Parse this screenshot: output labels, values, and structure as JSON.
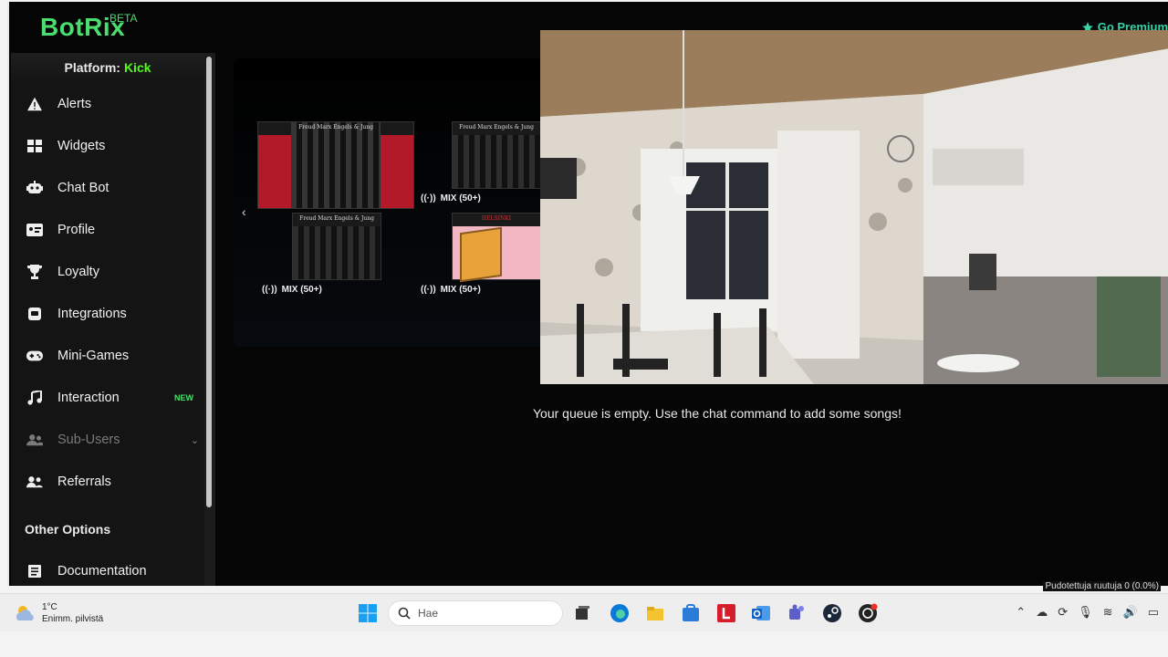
{
  "header": {
    "logo": "BotRix",
    "beta": "BETA",
    "premium": "Go Premium"
  },
  "sidebar": {
    "platform_label": "Platform:",
    "platform_value": "Kick",
    "items": [
      {
        "label": "Alerts",
        "icon": "warning-icon"
      },
      {
        "label": "Widgets",
        "icon": "grid-icon"
      },
      {
        "label": "Chat Bot",
        "icon": "robot-icon"
      },
      {
        "label": "Profile",
        "icon": "id-card-icon"
      },
      {
        "label": "Loyalty",
        "icon": "trophy-icon"
      },
      {
        "label": "Integrations",
        "icon": "integration-icon"
      },
      {
        "label": "Mini-Games",
        "icon": "gamepad-icon"
      },
      {
        "label": "Interaction",
        "icon": "music-icon",
        "badge": "NEW"
      },
      {
        "label": "Sub-Users",
        "icon": "users-icon"
      },
      {
        "label": "Referrals",
        "icon": "referrals-icon"
      }
    ],
    "other_options": "Other Options",
    "documentation": "Documentation"
  },
  "carousel": {
    "prev_glyph": "‹",
    "tiles": [
      {
        "caption": "Freud Marx Engels & Jung",
        "label": ""
      },
      {
        "caption": "Freud Marx Engels & Jung",
        "label": "MIX (50+)"
      },
      {
        "caption": "Freud Marx Engels & Jung",
        "label": "MIX (50+)"
      },
      {
        "caption": "HELSINKI",
        "label": "MIX (50+)"
      }
    ]
  },
  "player": {
    "queue_message": "Your queue is empty. Use the chat command to add some songs!"
  },
  "obs_status": "Pudotettuja ruutuja 0 (0.0%)",
  "taskbar": {
    "temperature": "1°C",
    "weather_desc": "Enimm. pilvistä",
    "search_placeholder": "Hae",
    "accent_edge": "#0a7ad6",
    "accent_red": "#d61d2b"
  }
}
